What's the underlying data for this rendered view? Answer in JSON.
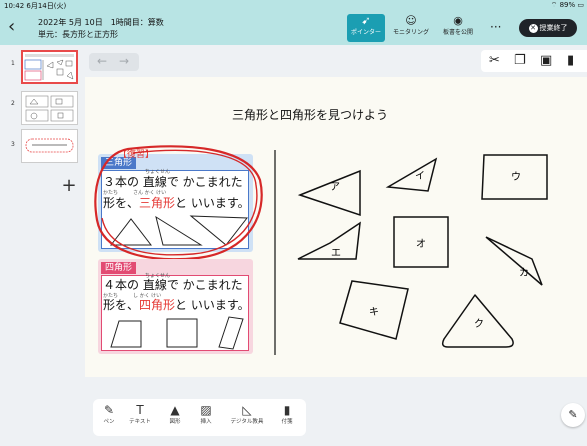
{
  "status": {
    "time": "10:42  6月14日(火)",
    "battery": "89%"
  },
  "header": {
    "back_icon": "chevron-left-icon",
    "title": "2022年 5月 10日　1時間目：算数",
    "unit": "単元：長方形と正方形",
    "buttons": [
      {
        "label": "ポインター",
        "icon": "cursor-icon"
      },
      {
        "label": "モニタリング",
        "icon": "face-icon"
      },
      {
        "label": "板書を公開",
        "icon": "eye-icon"
      }
    ],
    "more_label": "···",
    "end_label": "授業終了"
  },
  "sidebar": {
    "pages": [
      {
        "num": "1"
      },
      {
        "num": "2"
      },
      {
        "num": "3"
      }
    ],
    "add_label": "+"
  },
  "canvas": {
    "heading": "三角形と四角形を見つけよう",
    "review_label": "【復習】",
    "triangle_card": {
      "title": "三角形",
      "furigana1": "ちょくせん",
      "line1_a": "３本の ",
      "line1_b": "直線",
      "line1_c": "で かこまれた",
      "furigana2": "かたち　　　さん かく けい",
      "line2_a": "形を、",
      "line2_b": "三角形",
      "line2_c": "と いいます。"
    },
    "quad_card": {
      "title": "四角形",
      "furigana1": "ちょくせん",
      "line1_a": "４本の ",
      "line1_b": "直線",
      "line1_c": "で かこまれた",
      "furigana2": "かたち　　　し かく けい",
      "line2_a": "形を、",
      "line2_b": "四角形",
      "line2_c": "と いいます。"
    },
    "shapes": [
      "ア",
      "イ",
      "ウ",
      "エ",
      "オ",
      "カ",
      "キ",
      "ク"
    ]
  },
  "tools": [
    {
      "label": "ペン",
      "icon": "pen-icon"
    },
    {
      "label": "テキスト",
      "icon": "text-icon"
    },
    {
      "label": "図形",
      "icon": "shapes-icon"
    },
    {
      "label": "挿入",
      "icon": "image-icon"
    },
    {
      "label": "デジタル教具",
      "icon": "ruler-icon"
    },
    {
      "label": "付箋",
      "icon": "bookmark-icon"
    }
  ],
  "colors": {
    "header_bg": "#b8e4e4",
    "active_blue": "#1b9eb2",
    "triangle_blue": "#4a78c9",
    "quad_pink": "#e24b73",
    "highlight_red": "#e53935"
  }
}
